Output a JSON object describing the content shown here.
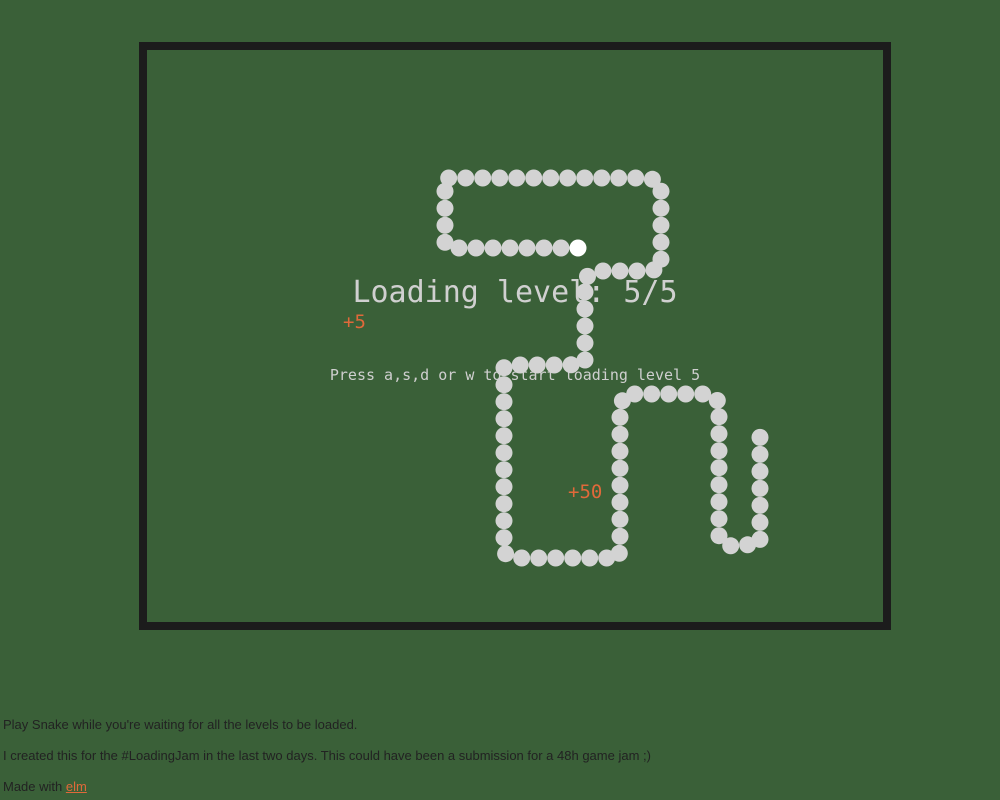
{
  "game": {
    "title": "Loading level: 5/5",
    "instructions": "Press a,s,d or w to start loading level 5",
    "score_popups": [
      "+5",
      "+50"
    ],
    "colors": {
      "background": "#3a6038",
      "border": "#1c1c1c",
      "snake_body": "#d3d3d3",
      "snake_head": "#ffffff",
      "text": "#d0d0d0",
      "score": "#e0693a"
    }
  },
  "footer": {
    "line1": "Play Snake while you're waiting for all the levels to be loaded.",
    "line2": "I created this for the #LoadingJam in the last two days. This could have been a submission for a 48h game jam ;)",
    "made_with_prefix": "Made with ",
    "made_with_link": "elm"
  }
}
